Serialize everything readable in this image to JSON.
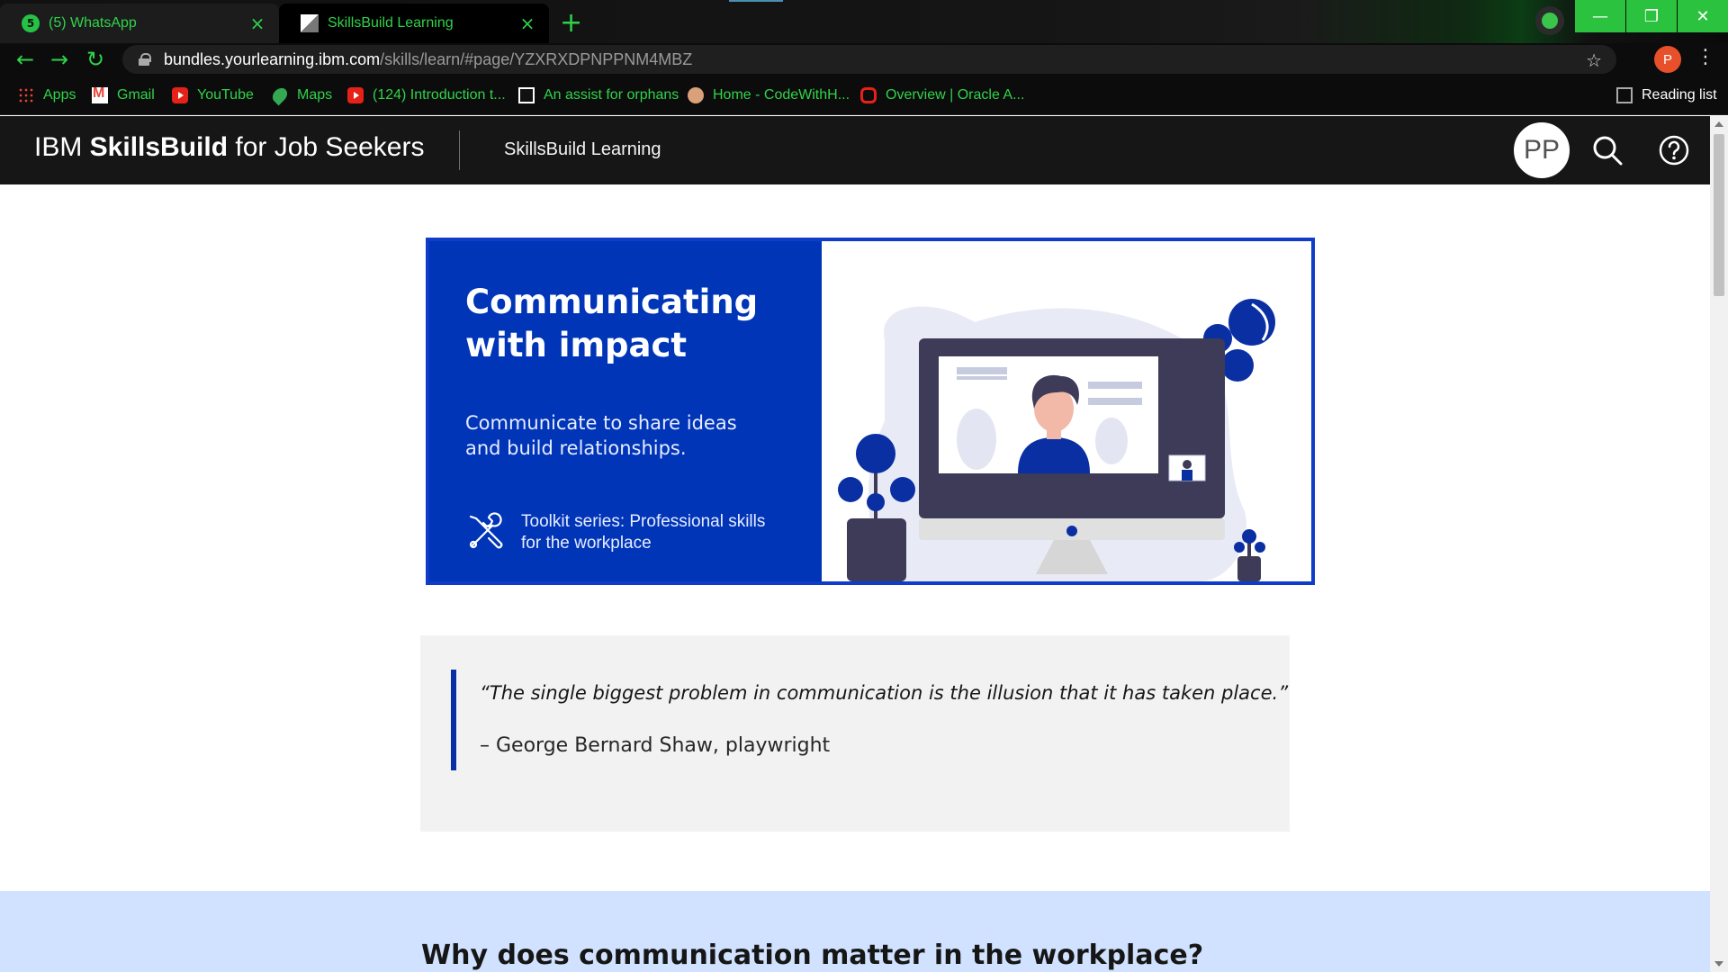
{
  "browser": {
    "tabs": [
      {
        "title": "(5) WhatsApp",
        "icon": "whatsapp-icon",
        "badge": "5"
      },
      {
        "title": "SkillsBuild Learning",
        "icon": "skillsbuild-favicon"
      }
    ],
    "new_tab_symbol": "+",
    "window_controls": {
      "minimize": "—",
      "restore": "❐",
      "close": "✕"
    },
    "url_host": "bundles.yourlearning.ibm.com",
    "url_path": "/skills/learn/#page/YZXRXDPNPPNM4MBZ",
    "profile_initial": "P",
    "bookmarks": [
      {
        "label": "Apps",
        "icon": "apps-icon"
      },
      {
        "label": "Gmail",
        "icon": "gmail-icon"
      },
      {
        "label": "YouTube",
        "icon": "youtube-icon"
      },
      {
        "label": "Maps",
        "icon": "maps-icon"
      },
      {
        "label": "(124) Introduction t...",
        "icon": "youtube-icon"
      },
      {
        "label": "An assist for orphans",
        "icon": "site-icon"
      },
      {
        "label": "Home - CodeWithH...",
        "icon": "codewithharry-icon"
      },
      {
        "label": "Overview | Oracle A...",
        "icon": "oracle-icon"
      }
    ],
    "reading_list": "Reading list",
    "accent_color": "#2fd34a"
  },
  "header": {
    "brand_prefix": "IBM ",
    "brand_bold": "SkillsBuild",
    "brand_suffix": " for Job Seekers",
    "nav_link": "SkillsBuild Learning",
    "avatar_initials": "PP"
  },
  "hero": {
    "title": "Communicating with impact",
    "subtitle": "Communicate to share ideas and build relationships.",
    "toolkit": "Toolkit series: Professional skills for the workplace",
    "brand_color": "#0035b8"
  },
  "quote": {
    "text": "“The single biggest problem in communication is the illusion that it has taken place.”",
    "author": "– George Bernard Shaw, playwright"
  },
  "section": {
    "heading": "Why does communication matter in the workplace?"
  }
}
